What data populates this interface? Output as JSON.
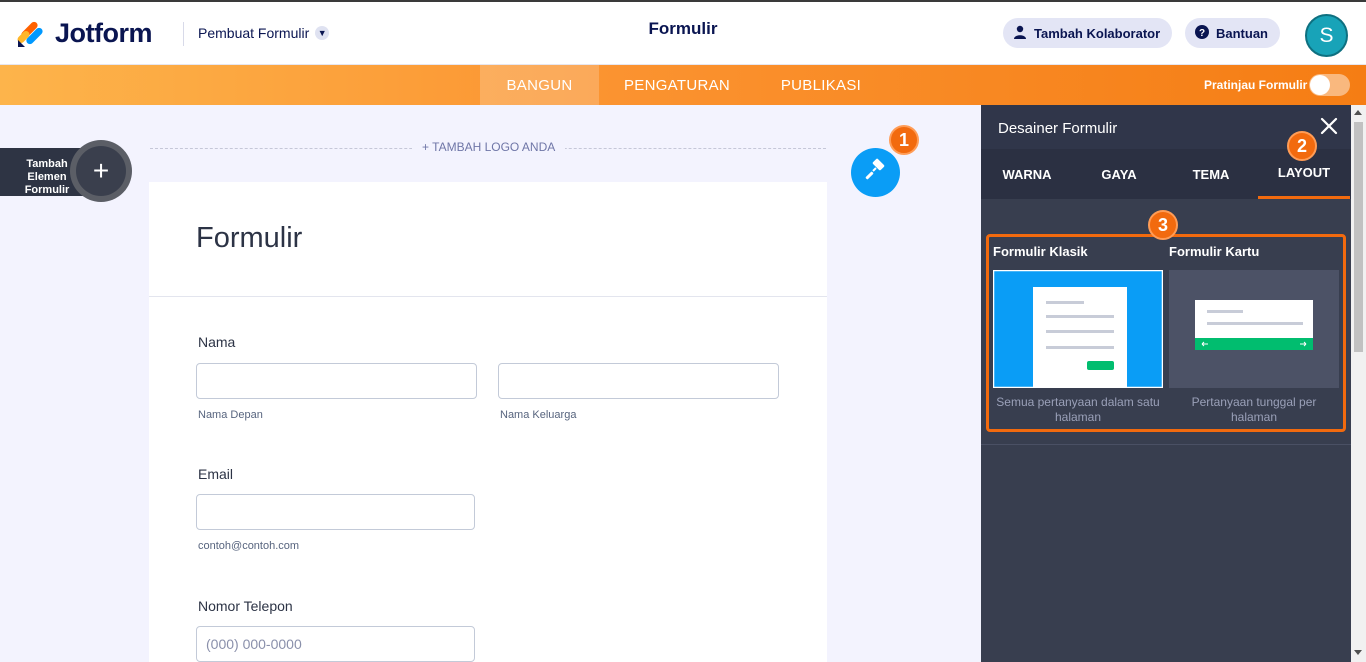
{
  "header": {
    "brand": "Jotform",
    "builder_label": "Pembuat Formulir",
    "form_title": "Formulir",
    "collaborator_button": "Tambah Kolaborator",
    "help_button": "Bantuan",
    "avatar_initial": "S"
  },
  "nav": {
    "tabs": [
      {
        "label": "BANGUN",
        "active": true
      },
      {
        "label": "PENGATURAN",
        "active": false
      },
      {
        "label": "PUBLIKASI",
        "active": false
      }
    ],
    "preview_label": "Pratinjau Formulir",
    "preview_on": false
  },
  "sidebar": {
    "add_element_label": "Tambah Elemen Formulir"
  },
  "canvas": {
    "add_logo": "+ TAMBAH LOGO ANDA"
  },
  "form": {
    "heading": "Formulir",
    "fields": {
      "name": {
        "label": "Nama",
        "first_sublabel": "Nama Depan",
        "last_sublabel": "Nama Keluarga",
        "first_value": "",
        "last_value": ""
      },
      "email": {
        "label": "Email",
        "sublabel": "contoh@contoh.com",
        "value": ""
      },
      "phone": {
        "label": "Nomor Telepon",
        "placeholder": "(000) 000-0000"
      }
    }
  },
  "badges": {
    "one": "1",
    "two": "2",
    "three": "3"
  },
  "designer": {
    "title": "Desainer Formulir",
    "tabs": [
      {
        "label": "WARNA",
        "active": false
      },
      {
        "label": "GAYA",
        "active": false
      },
      {
        "label": "TEMA",
        "active": false
      },
      {
        "label": "LAYOUT",
        "active": true
      }
    ],
    "layouts": [
      {
        "title": "Formulir Klasik",
        "description": "Semua pertanyaan dalam satu halaman",
        "selected": true
      },
      {
        "title": "Formulir Kartu",
        "description": "Pertanyaan tunggal per halaman",
        "selected": false
      }
    ]
  },
  "colors": {
    "brand_navy": "#0a1551",
    "accent_orange": "#f26a0e",
    "designer_blue": "#0a9df6",
    "submit_green": "#01bd6f"
  }
}
